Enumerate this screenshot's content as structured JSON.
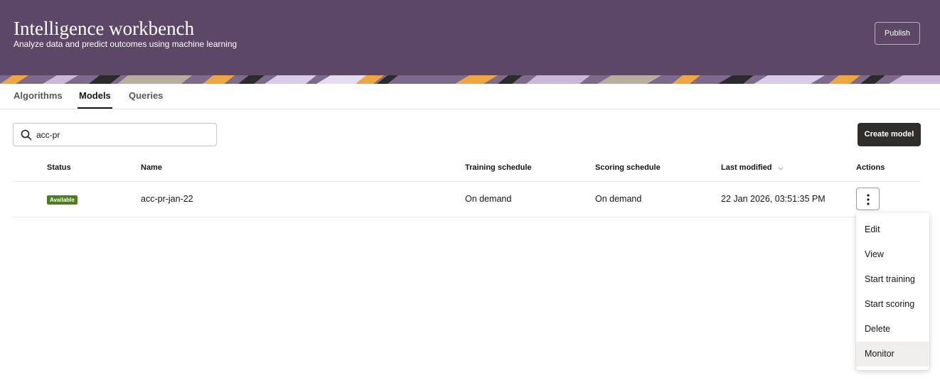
{
  "header": {
    "title": "Intelligence workbench",
    "subtitle": "Analyze data and predict outcomes using machine learning",
    "publish_label": "Publish",
    "background_color": "#5c4866"
  },
  "tabs": [
    {
      "label": "Algorithms",
      "active": false
    },
    {
      "label": "Models",
      "active": true
    },
    {
      "label": "Queries",
      "active": false
    }
  ],
  "search": {
    "value": "acc-pr",
    "icon": "search-icon"
  },
  "toolbar": {
    "create_label": "Create model",
    "create_color": "#312d2a"
  },
  "table": {
    "columns": {
      "status": "Status",
      "name": "Name",
      "training": "Training schedule",
      "scoring": "Scoring schedule",
      "modified": "Last modified",
      "actions": "Actions"
    },
    "sort": {
      "column": "Last modified",
      "icon": "chevron-down-icon"
    },
    "rows": [
      {
        "status": "Available",
        "status_color": "#4c7d1e",
        "name": "acc-pr-jan-22",
        "training": "On demand",
        "scoring": "On demand",
        "modified": "22 Jan 2026, 03:51:35 PM",
        "actions_icon": "more-vertical-icon"
      }
    ]
  },
  "actions_menu": {
    "items": [
      "Edit",
      "View",
      "Start training",
      "Start scoring",
      "Delete",
      "Monitor"
    ],
    "highlighted": "Monitor"
  }
}
